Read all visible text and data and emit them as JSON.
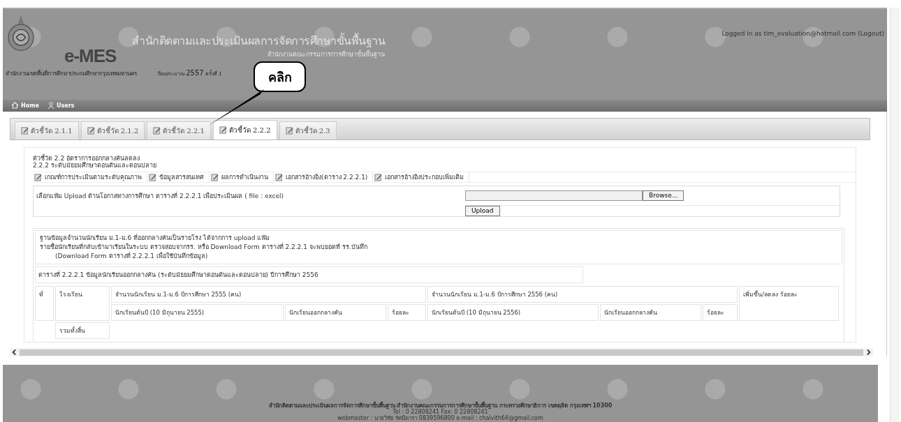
{
  "header": {
    "logo_text": "e-MES",
    "title": "สำนักติดตามและประเมินผลการจัดการศึกษาขั้นพื้นฐาน",
    "subtitle": "สำนักงานคณะกรรมการการศึกษาขั้นพื้นฐาน",
    "org": "สำนักงานเขตพื้นที่การศึกษาประถมศึกษากรุงเทพมหานคร",
    "budget_label": "ปีงบประมาณ",
    "budget_year": "2557",
    "round": "ครั้งที่ 1",
    "login_text": "Logged in as tim_evaluation@hotmail.com",
    "logout": "(Logout)"
  },
  "nav": [
    {
      "kind": "home",
      "label": "Home"
    },
    {
      "kind": "user",
      "label": "Users"
    }
  ],
  "tabs": [
    {
      "label": "ตัวชี้วัด 2.1.1",
      "selected": false
    },
    {
      "label": "ตัวชี้วัด 2.1.2",
      "selected": false
    },
    {
      "label": "ตัวชี้วัด 2.2.1",
      "selected": false
    },
    {
      "label": "ตัวชี้วัด 2.2.2",
      "selected": true
    },
    {
      "label": "ตัวชี้วัด 2.3",
      "selected": false
    }
  ],
  "callout": "คลิก",
  "heading": [
    "ตัวชี้วัด 2.2 อัตราการออกกลางคันลดลง",
    "2.2.2 ระดับมัธยมศึกษาตอนต้นและตอนปลาย"
  ],
  "subtabs": [
    "เกณฑ์การประเมินตามระดับคุณภาพ",
    "ข้อมูลสารสนเทศ",
    "ผลการดำเนินงาน",
    "เอกสารอ้างอิง(ตาราง 2.2.2.1)",
    "เอกสารอ้างอิงประกอบเพิ่มเติม"
  ],
  "upload": {
    "label": "เลือกแฟ้ม Upload ด้านโอกาสทางการศึกษา ตารางที่ 2.2.2.1 เพื่อประเมินผล ( file : excel)",
    "browse_button": "Browse...",
    "upload_button": "Upload"
  },
  "info": [
    "ฐานข้อมูลจำนวนนักเรียน ม.1-ม.6 ที่ออกกลางคันเป็นรายโรง ได้จากการ upload แฟ้ม",
    "รายชื่อนักเรียนที่กลับเข้ามาเรียนในระบบ ตรวจสอบจากรร. หรือ Download Form ตารางที่ 2.2.2.1 จะพบยอดที่ รร.บันทึก",
    "(Download Form ตารางที่ 2.2.2.1 เพื่อใช้บันทึกข้อมูล)"
  ],
  "table": {
    "caption": "ตารางที่ 2.2.2.1 ข้อมูลนักเรียนออกกลางคัน (ระดับมัธยมศึกษาตอนต้นและตอนปลาย) ปีการศึกษา 2556",
    "col_no": "ที่",
    "col_school": "โรงเรียน",
    "group_2555": "จำนวนนักเรียน ม.1-ม.6 ปีการศึกษา 2555 (คน)",
    "group_2556": "จำนวนนักเรียน ม.1-ม.6 ปีการศึกษา 2556 (คน)",
    "col_change": "เพิ่มขึ้น/ลดลง ร้อยละ",
    "sub_2555": [
      "นักเรียนต้นปี (10 มิถุนายน 2555)",
      "นักเรียนออกกลางคัน",
      "ร้อยละ"
    ],
    "sub_2556": [
      "นักเรียนต้นปี (10 มิถุนายน 2556)",
      "นักเรียนออกกลางคัน",
      "ร้อยละ"
    ],
    "total_label": "รวมทั้งสิ้น"
  },
  "footer": [
    "สำนักติดตามและประเมินผลการจัดการศึกษาขั้นพื้นฐาน สำนักงานคณะกรรมการการศึกษาขั้นพื้นฐาน กระทรวงศึกษาธิการ เขตดุสิต กรุงเทพฯ 10300",
    "Tel : 0 22808241 Fax: 0 22808241",
    "webmaster : นายวิชัย รัศมีดารา 0839596800 e-mail : chaivith64@gmail.com"
  ]
}
